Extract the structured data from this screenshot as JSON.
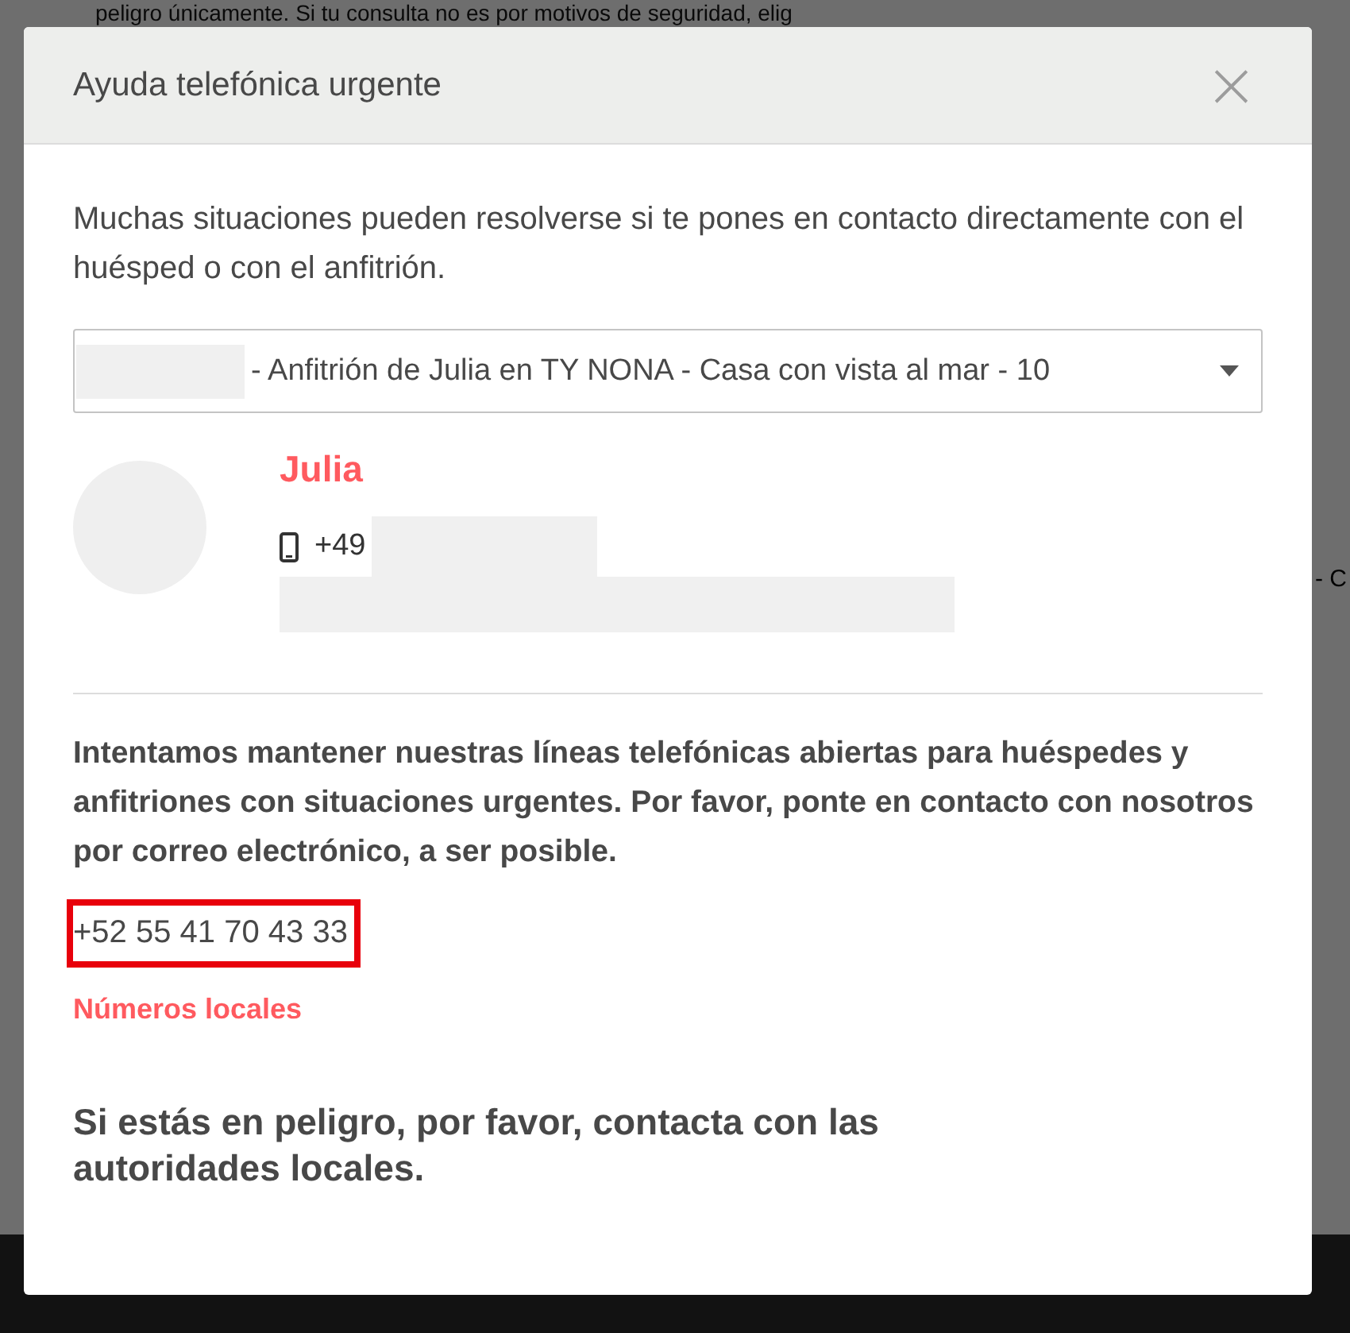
{
  "background": {
    "text": "peligro únicamente. Si tu consulta no es por motivos de seguridad, elig",
    "side_fragment": "- C"
  },
  "dialog": {
    "title": "Ayuda telefónica urgente",
    "close": "×",
    "intro": "Muchas situaciones pueden resolverse si te pones en contacto directamente con el huésped o con el anfitrión.",
    "reservation_select": {
      "value": "- Anfitrión de Julia en TY NONA - Casa con vista al mar - 10"
    },
    "contact": {
      "name": "Julia",
      "phone_prefix": "+49"
    },
    "notice": "Intentamos mantener nuestras líneas telefónicas abiertas para huéspedes y anfitriones con situaciones urgentes. Por favor, ponte en contacto con nosotros por correo electrónico, a ser posible.",
    "support_number": {
      "text": "+52 55 41 70 43 33",
      "highlighted": true
    },
    "local_numbers_link": "Números locales",
    "danger_note": "Si estás en peligro, por favor, contacta con las autoridades locales."
  }
}
